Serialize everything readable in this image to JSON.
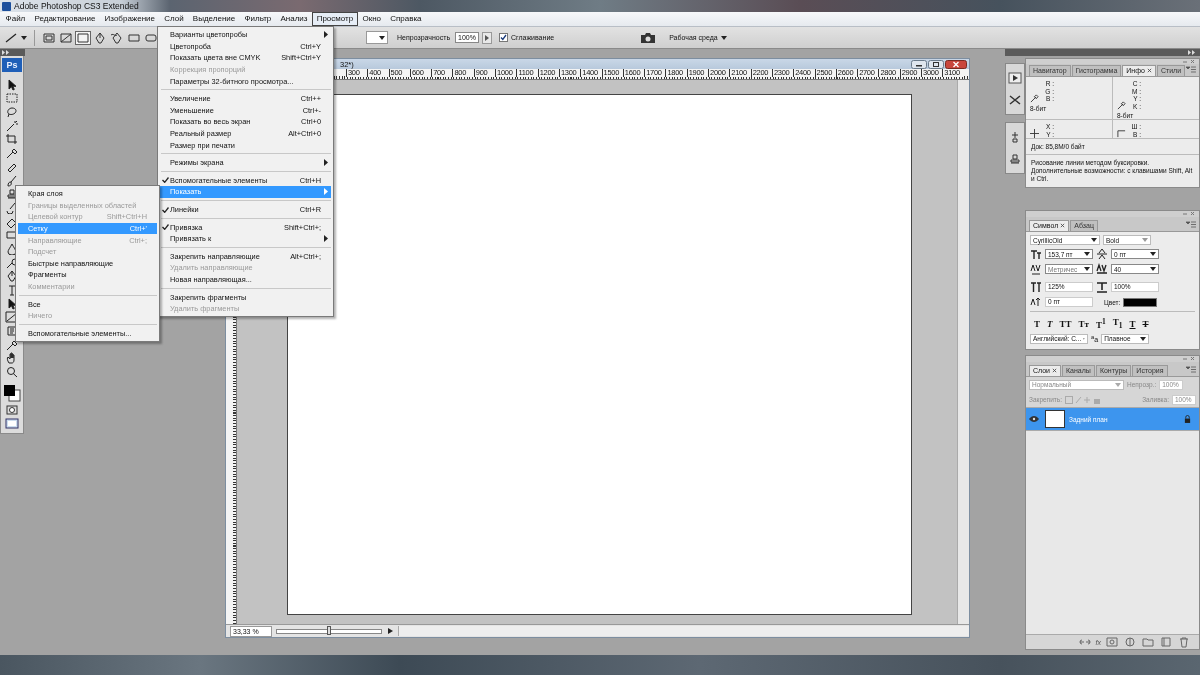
{
  "window": {
    "title": "Adobe Photoshop CS3 Extended"
  },
  "menu_bar": [
    {
      "label": "Файл",
      "selected": false
    },
    {
      "label": "Редактирование",
      "selected": false
    },
    {
      "label": "Изображение",
      "selected": false
    },
    {
      "label": "Слой",
      "selected": false
    },
    {
      "label": "Выделение",
      "selected": false
    },
    {
      "label": "Фильтр",
      "selected": false
    },
    {
      "label": "Анализ",
      "selected": false
    },
    {
      "label": "Просмотр",
      "selected": true
    },
    {
      "label": "Окно",
      "selected": false
    },
    {
      "label": "Справка",
      "selected": false
    }
  ],
  "options_bar": {
    "opacity_label": "Непрозрачность",
    "opacity": "100%",
    "antialias": {
      "label": "Сглаживание",
      "checked": true
    },
    "workspace": "Рабочая среда"
  },
  "view_menu": [
    {
      "kind": "item",
      "label": "Варианты цветопробы",
      "checked": false,
      "disabled": false,
      "selected": false,
      "submenu": true
    },
    {
      "kind": "item",
      "label": "Цветопроба",
      "shortcut": "Ctrl+Y",
      "checked": false,
      "disabled": false,
      "selected": false,
      "submenu": false
    },
    {
      "kind": "item",
      "label": "Показать цвета вне CMYK",
      "shortcut": "Shift+Ctrl+Y",
      "checked": false,
      "disabled": false,
      "selected": false,
      "submenu": false
    },
    {
      "kind": "item",
      "label": "Коррекция пропорций",
      "checked": false,
      "disabled": true,
      "selected": false,
      "submenu": false
    },
    {
      "kind": "item",
      "label": "Параметры 32-битного просмотра...",
      "checked": false,
      "disabled": false,
      "selected": false,
      "submenu": false
    },
    {
      "kind": "separator"
    },
    {
      "kind": "item",
      "label": "Увеличение",
      "shortcut": "Ctrl++",
      "checked": false,
      "disabled": false,
      "selected": false,
      "submenu": false
    },
    {
      "kind": "item",
      "label": "Уменьшение",
      "shortcut": "Ctrl+-",
      "checked": false,
      "disabled": false,
      "selected": false,
      "submenu": false
    },
    {
      "kind": "item",
      "label": "Показать во весь экран",
      "shortcut": "Ctrl+0",
      "checked": false,
      "disabled": false,
      "selected": false,
      "submenu": false
    },
    {
      "kind": "item",
      "label": "Реальный размер",
      "shortcut": "Alt+Ctrl+0",
      "checked": false,
      "disabled": false,
      "selected": false,
      "submenu": false
    },
    {
      "kind": "item",
      "label": "Размер при печати",
      "checked": false,
      "disabled": false,
      "selected": false,
      "submenu": false
    },
    {
      "kind": "separator"
    },
    {
      "kind": "item",
      "label": "Режимы экрана",
      "checked": false,
      "disabled": false,
      "selected": false,
      "submenu": true
    },
    {
      "kind": "separator"
    },
    {
      "kind": "item",
      "label": "Вспомогательные элементы",
      "shortcut": "Ctrl+H",
      "checked": true,
      "disabled": false,
      "selected": false,
      "submenu": false
    },
    {
      "kind": "item",
      "label": "Показать",
      "checked": false,
      "disabled": false,
      "selected": true,
      "submenu": true
    },
    {
      "kind": "separator"
    },
    {
      "kind": "item",
      "label": "Линейки",
      "shortcut": "Ctrl+R",
      "checked": true,
      "disabled": false,
      "selected": false,
      "submenu": false
    },
    {
      "kind": "separator"
    },
    {
      "kind": "item",
      "label": "Привязка",
      "shortcut": "Shift+Ctrl+;",
      "checked": true,
      "disabled": false,
      "selected": false,
      "submenu": false
    },
    {
      "kind": "item",
      "label": "Привязать к",
      "checked": false,
      "disabled": false,
      "selected": false,
      "submenu": true
    },
    {
      "kind": "separator"
    },
    {
      "kind": "item",
      "label": "Закрепить направляющие",
      "shortcut": "Alt+Ctrl+;",
      "checked": false,
      "disabled": false,
      "selected": false,
      "submenu": false
    },
    {
      "kind": "item",
      "label": "Удалить направляющие",
      "checked": false,
      "disabled": true,
      "selected": false,
      "submenu": false
    },
    {
      "kind": "item",
      "label": "Новая направляющая...",
      "checked": false,
      "disabled": false,
      "selected": false,
      "submenu": false
    },
    {
      "kind": "separator"
    },
    {
      "kind": "item",
      "label": "Закрепить фрагменты",
      "checked": false,
      "disabled": false,
      "selected": false,
      "submenu": false
    },
    {
      "kind": "item",
      "label": "Удалить фрагменты",
      "checked": false,
      "disabled": true,
      "selected": false,
      "submenu": false
    }
  ],
  "show_submenu": [
    {
      "kind": "item",
      "label": "Края слоя",
      "checked": false,
      "disabled": false,
      "selected": false,
      "submenu": false
    },
    {
      "kind": "item",
      "label": "Границы выделенных областей",
      "checked": false,
      "disabled": true,
      "selected": false,
      "submenu": false
    },
    {
      "kind": "item",
      "label": "Целевой контур",
      "shortcut": "Shift+Ctrl+H",
      "checked": false,
      "disabled": true,
      "selected": false,
      "submenu": false
    },
    {
      "kind": "item",
      "label": "Сетку",
      "shortcut": "Ctrl+'",
      "checked": false,
      "disabled": false,
      "selected": true,
      "submenu": false
    },
    {
      "kind": "item",
      "label": "Направляющие",
      "shortcut": "Ctrl+;",
      "checked": false,
      "disabled": true,
      "selected": false,
      "submenu": false
    },
    {
      "kind": "item",
      "label": "Подсчет",
      "checked": false,
      "disabled": true,
      "selected": false,
      "submenu": false
    },
    {
      "kind": "item",
      "label": "Быстрые направляющие",
      "checked": false,
      "disabled": false,
      "selected": false,
      "submenu": false
    },
    {
      "kind": "item",
      "label": "Фрагменты",
      "checked": false,
      "disabled": false,
      "selected": false,
      "submenu": false
    },
    {
      "kind": "item",
      "label": "Комментарии",
      "checked": false,
      "disabled": true,
      "selected": false,
      "submenu": false
    },
    {
      "kind": "separator"
    },
    {
      "kind": "item",
      "label": "Все",
      "checked": false,
      "disabled": false,
      "selected": false,
      "submenu": false
    },
    {
      "kind": "item",
      "label": "Ничего",
      "checked": false,
      "disabled": true,
      "selected": false,
      "submenu": false
    },
    {
      "kind": "separator"
    },
    {
      "kind": "item",
      "label": "Вспомогательные элементы...",
      "checked": false,
      "disabled": false,
      "selected": false,
      "submenu": false
    }
  ],
  "document": {
    "title": "32*)",
    "ruler_labels": [
      "300",
      "400",
      "500",
      "600",
      "700",
      "800",
      "900",
      "1000",
      "1100",
      "1200",
      "1300",
      "1400",
      "1500",
      "1600",
      "1700",
      "1800",
      "1900",
      "2000",
      "2100",
      "2200",
      "2300",
      "2400",
      "2500",
      "2600",
      "2700",
      "2800",
      "2900",
      "3000",
      "3100"
    ],
    "zoom": "33,33 %",
    "zoom_slider": {
      "level": 0.5
    }
  },
  "toolbox": {
    "logo": "Ps"
  },
  "info_panel": {
    "tabs": [
      {
        "label": "Навигатор",
        "selected": false
      },
      {
        "label": "Гистограмма",
        "selected": false
      },
      {
        "label": "Инфо",
        "selected": true
      },
      {
        "label": "Стили",
        "selected": false
      }
    ],
    "rgb": [
      "R :",
      "G :",
      "B :"
    ],
    "rgb_depth": "8-бит",
    "cmyk": [
      "C :",
      "M :",
      "Y :",
      "K :"
    ],
    "cmyk_depth": "8-бит",
    "xy": [
      "X :",
      "Y :"
    ],
    "wh": [
      "Ш :",
      "В :"
    ],
    "doc": "Док: 85,8M/0 байт",
    "hint": "Рисование линии методом буксировки. Дополнительные возможности: с клавишами Shift, Alt и Ctrl."
  },
  "character_panel": {
    "tabs": [
      {
        "label": "Символ",
        "selected": true
      },
      {
        "label": "Абзац",
        "selected": false
      }
    ],
    "font_family": "CyrillicOld",
    "font_style": "Bold",
    "size": "153,7 пт",
    "leading": "0 пт",
    "kerning": "Метричес",
    "tracking": "40",
    "vertical_scale": "125%",
    "horizontal_scale": "100%",
    "baseline_shift": "0 пт",
    "color_label": "Цвет:",
    "color": "#000000",
    "styles": [
      {
        "glyph": "T",
        "kind": "bold"
      },
      {
        "glyph": "T",
        "kind": "italic"
      },
      {
        "glyph": "TT",
        "kind": "caps"
      },
      {
        "glyph": "Tт",
        "kind": "smallcaps"
      },
      {
        "glyph": "T$^{1}$",
        "kind": "plain"
      },
      {
        "glyph": "T$_{1}$",
        "kind": "plain"
      },
      {
        "glyph": "T",
        "kind": "underline"
      },
      {
        "glyph": "T",
        "kind": "strike"
      }
    ],
    "language": "Английский: С...",
    "antialias_glyph": "$^{a}$a",
    "antialias": "Плавное"
  },
  "layers_panel": {
    "tabs": [
      {
        "label": "Слои",
        "selected": true
      },
      {
        "label": "Каналы",
        "selected": false
      },
      {
        "label": "Контуры",
        "selected": false
      },
      {
        "label": "История",
        "selected": false
      }
    ],
    "blend_mode": "Нормальный",
    "opacity_label": "Непрозр.:",
    "opacity": "100%",
    "lock_label": "Закрепить:",
    "fill_label": "Заливка:",
    "fill": "100%",
    "layers": [
      {
        "name": "Задний план",
        "selected": true,
        "visible": true,
        "locked": true
      }
    ],
    "footer_fx": "fx"
  }
}
